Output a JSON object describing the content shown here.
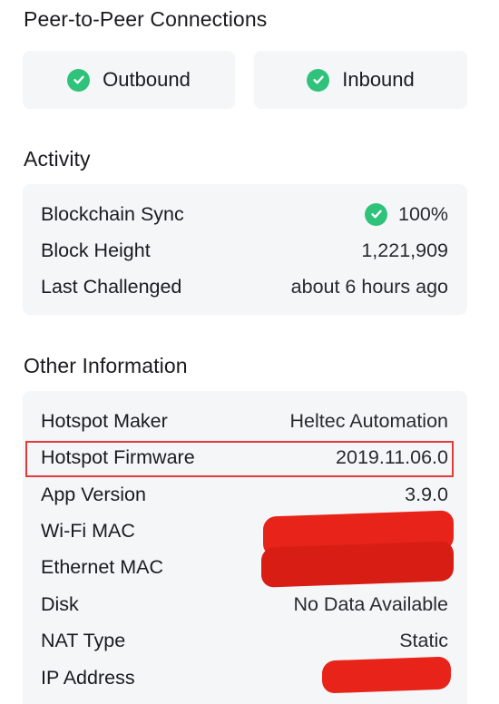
{
  "p2p": {
    "title": "Peer-to-Peer Connections",
    "outbound_label": "Outbound",
    "inbound_label": "Inbound"
  },
  "activity": {
    "title": "Activity",
    "rows": [
      {
        "label": "Blockchain Sync",
        "value": "100%",
        "icon": "check-circle-icon"
      },
      {
        "label": "Block Height",
        "value": "1,221,909"
      },
      {
        "label": "Last Challenged",
        "value": "about 6 hours ago"
      }
    ]
  },
  "other": {
    "title": "Other Information",
    "rows": [
      {
        "label": "Hotspot Maker",
        "value": "Heltec Automation"
      },
      {
        "label": "Hotspot Firmware",
        "value": "2019.11.06.0"
      },
      {
        "label": "App Version",
        "value": "3.9.0"
      },
      {
        "label": "Wi-Fi MAC",
        "value": ""
      },
      {
        "label": "Ethernet MAC",
        "value": ""
      },
      {
        "label": "Disk",
        "value": "No Data Available"
      },
      {
        "label": "NAT Type",
        "value": "Static"
      },
      {
        "label": "IP Address",
        "value": ""
      }
    ]
  },
  "colors": {
    "check_green": "#2fc27b",
    "card_bg": "#f5f6f8",
    "highlight_red": "#e23b3b",
    "redaction_red": "#e8231a"
  }
}
